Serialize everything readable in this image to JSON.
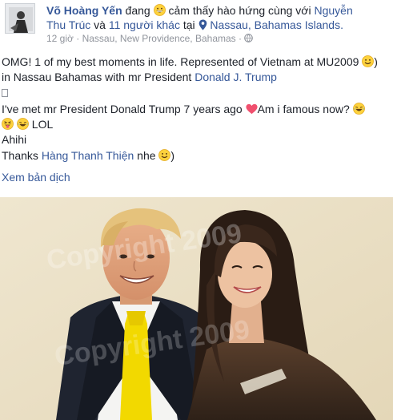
{
  "post": {
    "author": "Võ Hoàng Yến",
    "activity_prefix": "đang",
    "feeling_icon": "grinning-emoji-icon",
    "feeling_text": "cảm thấy hào hứng cùng với",
    "tag_person": "Nguyễn Thu Trúc",
    "tag_person_part1": "Nguyễn",
    "tag_person_part2": "Thu Trúc",
    "and_text": "và",
    "others": "11 người khác",
    "at_text": "tại",
    "location_icon": "map-pin-icon",
    "location": "Nassau, Bahamas Islands.",
    "time": "12 giờ",
    "meta_separator": "·",
    "place": "Nassau, New Providence, Bahamas",
    "place_separator": "·",
    "audience_icon": "globe-icon"
  },
  "content": {
    "line1": "OMG! 1 of my best moments in life. Represented of Vietnam at MU2009",
    "line1_suffix": ")",
    "line2_prefix": "in Nassau Bahamas with mr President",
    "line2_link": "Donald J. Trump",
    "line3": "",
    "line4": "I've met mr President Donald Trump 7 years ago",
    "line4_after_heart": "Am i famous now?",
    "line5": "LOL",
    "line6": "Ahihi",
    "line7_prefix": "Thanks",
    "line7_link": "Hàng Thanh Thiện",
    "line7_suffix": "nhe",
    "line7_end": ")"
  },
  "translate_link": "Xem bản dịch",
  "photo": {
    "watermark": "Copyright 2009"
  },
  "colors": {
    "link": "#365899",
    "text": "#1d2129",
    "meta": "#90949c",
    "heart": "#f0506e",
    "emoji": "#fdd23d",
    "tie": "#f2d900"
  }
}
